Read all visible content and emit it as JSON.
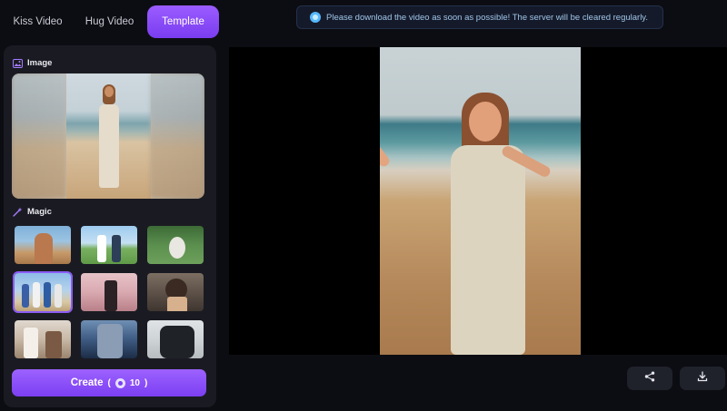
{
  "tabs": [
    {
      "label": "Kiss Video",
      "active": false
    },
    {
      "label": "Hug Video",
      "active": false
    },
    {
      "label": "Template",
      "active": true
    }
  ],
  "panel": {
    "image_title": "Image",
    "magic_title": "Magic",
    "selected_template_index": 3,
    "template_count": 9
  },
  "create": {
    "label": "Create",
    "open_paren": "(",
    "cost": "10",
    "close_paren": ")"
  },
  "notice": {
    "text": "Please download the video as soon as possible! The server will be cleared regularly."
  },
  "actions": {
    "share_icon": "share-icon",
    "download_icon": "download-icon"
  },
  "colors": {
    "accent": "#8b5cf6",
    "panel_bg": "#1a1b22",
    "page_bg": "#0c0d12",
    "notice_text": "#9fc6e8"
  }
}
